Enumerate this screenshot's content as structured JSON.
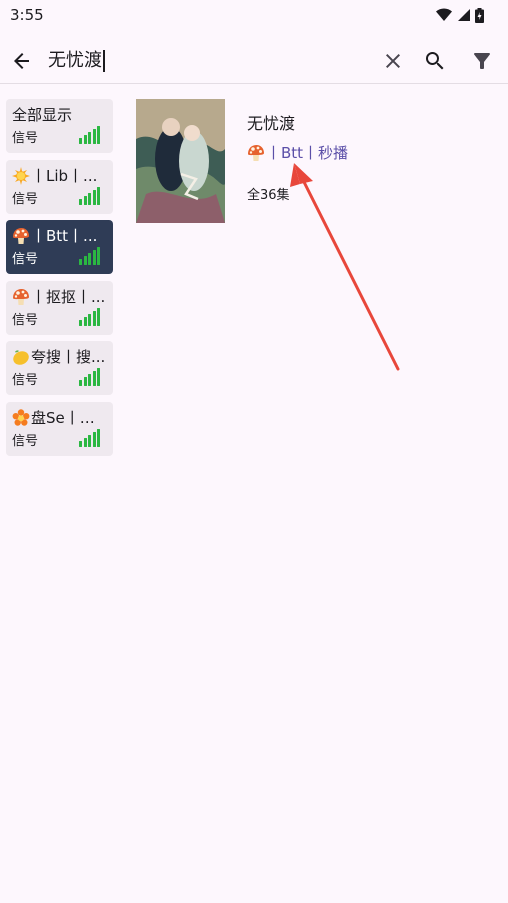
{
  "status_bar": {
    "time": "3:55"
  },
  "search": {
    "query": "无忧渡"
  },
  "sources": [
    {
      "emoji": "sun",
      "label": "🌟丨Lib丨...",
      "name": "全部显示",
      "signal": "信号",
      "level": 5
    }
  ],
  "source_list": [
    {
      "name": "全部显示",
      "emoji": "",
      "signal": "信号",
      "level": 5,
      "selected": false
    },
    {
      "name": "丨Lib丨...",
      "emoji": "star",
      "signal": "信号",
      "level": 5,
      "selected": false
    },
    {
      "name": "丨Btt丨...",
      "emoji": "mushroom",
      "signal": "信号",
      "level": 5,
      "selected": true
    },
    {
      "name": "丨抠抠丨...",
      "emoji": "mushroom",
      "signal": "信号",
      "level": 5,
      "selected": false
    },
    {
      "name": "夸搜丨搜...",
      "emoji": "lemon",
      "signal": "信号",
      "level": 5,
      "selected": false
    },
    {
      "name": "盘Se丨搜...",
      "emoji": "flower",
      "signal": "信号",
      "level": 5,
      "selected": false
    }
  ],
  "result": {
    "title": "无忧渡",
    "source": "丨Btt丨秒播",
    "episodes": "全36集"
  },
  "colors": {
    "background": "#fdf7fd",
    "selected_source": "#2f3c56",
    "signal": "#2bb742",
    "source_link": "#5b4fa8",
    "arrow": "#e8473b"
  }
}
